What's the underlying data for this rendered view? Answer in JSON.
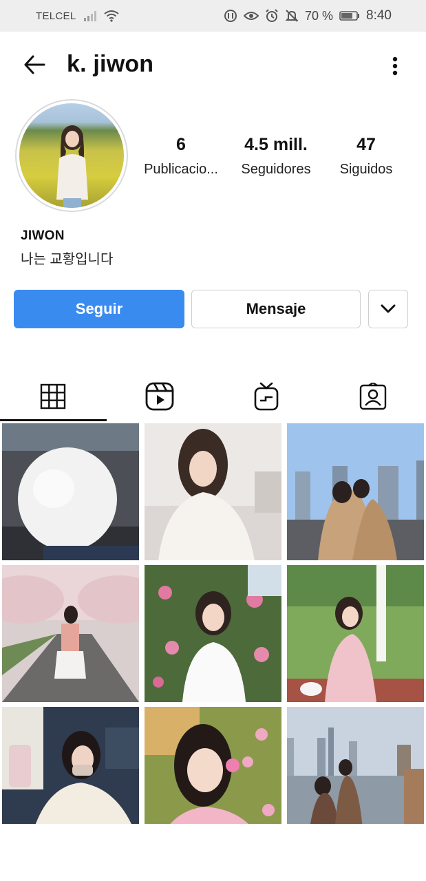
{
  "status_bar": {
    "carrier": "TELCEL",
    "battery": "70 %",
    "time": "8:40"
  },
  "header": {
    "username": "k. jiwon"
  },
  "profile": {
    "stats": [
      {
        "value": "6",
        "label": "Publicacio..."
      },
      {
        "value": "4.5 mill.",
        "label": "Seguidores"
      },
      {
        "value": "47",
        "label": "Siguidos"
      }
    ],
    "name": "JIWON",
    "bio": "나는 교황입니다"
  },
  "actions": {
    "follow_label": "Seguir",
    "message_label": "Mensaje"
  },
  "tabs": [
    {
      "icon": "grid-icon",
      "active": true
    },
    {
      "icon": "reels-icon",
      "active": false
    },
    {
      "icon": "igtv-icon",
      "active": false
    },
    {
      "icon": "tagged-icon",
      "active": false
    }
  ],
  "colors": {
    "follow_button": "#3a8bf0",
    "status_bar_bg": "#eeeeee"
  }
}
